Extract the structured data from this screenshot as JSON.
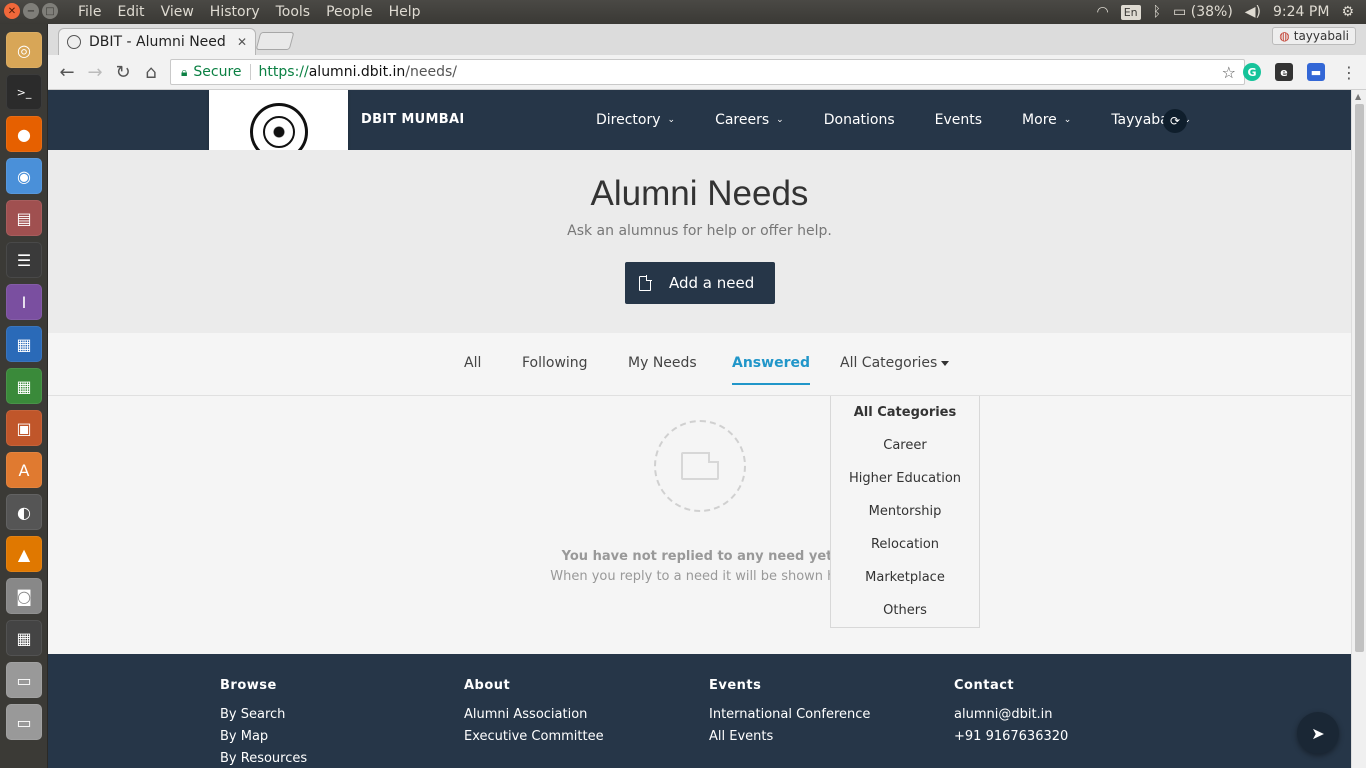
{
  "os": {
    "menu": [
      "File",
      "Edit",
      "View",
      "History",
      "Tools",
      "People",
      "Help"
    ],
    "keyboard": "En",
    "battery": "(38%)",
    "clock": "9:24 PM"
  },
  "browser": {
    "tab_title": "DBIT - Alumni Need",
    "profile_name": "tayyabali",
    "secure_label": "Secure",
    "url_scheme": "https://",
    "url_host": "alumni.dbit.in",
    "url_path": "/needs/"
  },
  "site": {
    "brand": "DBIT MUMBAI",
    "nav": {
      "directory": "Directory",
      "careers": "Careers",
      "donations": "Donations",
      "events": "Events",
      "more": "More",
      "user": "Tayyabali"
    },
    "hero": {
      "title": "Alumni Needs",
      "subtitle": "Ask an alumnus for help or offer help.",
      "add_button": "Add a need"
    },
    "filters": {
      "all": "All",
      "following": "Following",
      "my_needs": "My Needs",
      "answered": "Answered",
      "categories": "All Categories"
    },
    "categories_menu": [
      "All Categories",
      "Career",
      "Higher Education",
      "Mentorship",
      "Relocation",
      "Marketplace",
      "Others"
    ],
    "empty": {
      "title": "You have not replied to any need yet.",
      "subtitle": "When you reply to a need it will be shown her"
    },
    "footer": {
      "browse": {
        "heading": "Browse",
        "links": [
          "By Search",
          "By Map",
          "By Resources"
        ]
      },
      "about": {
        "heading": "About",
        "links": [
          "Alumni Association",
          "Executive Committee"
        ]
      },
      "events": {
        "heading": "Events",
        "links": [
          "International Conference",
          "All Events"
        ]
      },
      "contact": {
        "heading": "Contact",
        "links": [
          "alumni@dbit.in",
          "+91 9167636320"
        ]
      }
    }
  },
  "colors": {
    "navy": "#263648",
    "accent": "#2196c9",
    "secure_green": "#0b8043"
  }
}
